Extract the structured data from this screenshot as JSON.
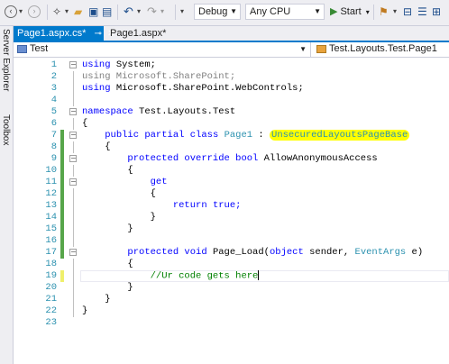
{
  "toolbar": {
    "config": "Debug",
    "platform": "Any CPU",
    "start_label": "Start"
  },
  "side_panel": {
    "server_explorer": "Server Explorer",
    "toolbox": "Toolbox"
  },
  "tabs": [
    {
      "label": "Page1.aspx.cs*",
      "active": true
    },
    {
      "label": "Page1.aspx*",
      "active": false
    }
  ],
  "nav": {
    "project": "Test",
    "class_path": "Test.Layouts.Test.Page1"
  },
  "editor": {
    "lines": [
      {
        "n": "1",
        "change": ""
      },
      {
        "n": "2",
        "change": ""
      },
      {
        "n": "3",
        "change": ""
      },
      {
        "n": "4",
        "change": ""
      },
      {
        "n": "5",
        "change": ""
      },
      {
        "n": "6",
        "change": ""
      },
      {
        "n": "7",
        "change": "green"
      },
      {
        "n": "8",
        "change": "green"
      },
      {
        "n": "9",
        "change": "green"
      },
      {
        "n": "10",
        "change": "green"
      },
      {
        "n": "11",
        "change": "green"
      },
      {
        "n": "12",
        "change": "green"
      },
      {
        "n": "13",
        "change": "green"
      },
      {
        "n": "14",
        "change": "green"
      },
      {
        "n": "15",
        "change": "green"
      },
      {
        "n": "16",
        "change": "green"
      },
      {
        "n": "17",
        "change": "green"
      },
      {
        "n": "18",
        "change": ""
      },
      {
        "n": "19",
        "change": "yellow"
      },
      {
        "n": "20",
        "change": ""
      },
      {
        "n": "21",
        "change": ""
      },
      {
        "n": "22",
        "change": ""
      },
      {
        "n": "23",
        "change": ""
      }
    ],
    "tokens": {
      "using": "using",
      "system": "System;",
      "using_sp": "using Microsoft.SharePoint;",
      "sp_webcontrols": "Microsoft.SharePoint.WebControls;",
      "namespace": "namespace",
      "ns_name": "Test.Layouts.Test",
      "open_brace": "{",
      "close_brace": "}",
      "public_partial_class": "public partial class",
      "page1": "Page1",
      "colon": ":",
      "base_class": "UnsecuredLayoutsPageBase",
      "protected_override_bool": "protected override bool",
      "prop_name": "AllowAnonymousAccess",
      "get": "get",
      "return": "return",
      "true": "true;",
      "protected_void": "protected void",
      "page_load": "Page_Load(",
      "object": "object",
      "sender": "sender,",
      "eventargs": "EventArgs",
      "e_paren": "e)",
      "comment": "//Ur code gets here"
    }
  },
  "colors": {
    "keyword": "#0000FF",
    "type": "#2B91AF",
    "comment": "#008000",
    "highlight": "#FFFF00",
    "accent": "#007ACC"
  }
}
